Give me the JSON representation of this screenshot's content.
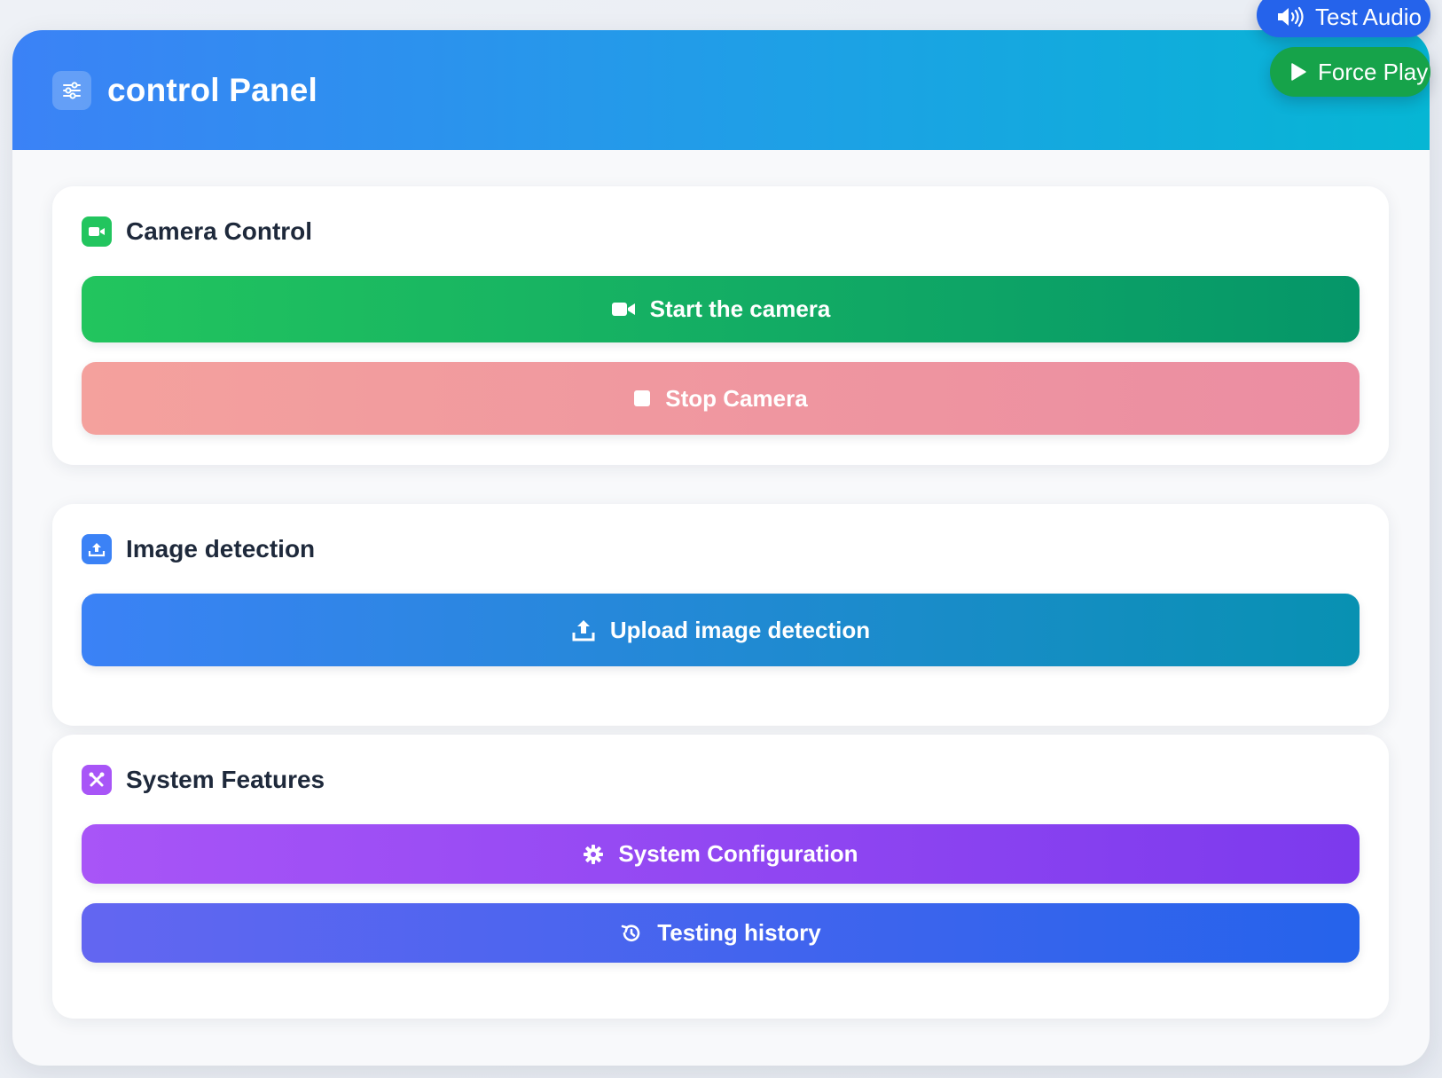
{
  "header": {
    "title": "control Panel",
    "icon": "sliders-icon"
  },
  "floating": {
    "test_audio_label": "Test Audio",
    "force_play_label": "Force Play"
  },
  "sections": {
    "camera": {
      "title": "Camera Control",
      "start_label": "Start the camera",
      "stop_label": "Stop Camera"
    },
    "image": {
      "title": "Image detection",
      "upload_label": "Upload image detection"
    },
    "system": {
      "title": "System Features",
      "config_label": "System Configuration",
      "history_label": "Testing history"
    }
  },
  "colors": {
    "header_start": "#3b82f6",
    "header_end": "#06b6d4",
    "green_start": "#22c55e",
    "green_end": "#059669",
    "stop_start": "#f4a19d",
    "stop_end": "#eb8da2",
    "upload_start": "#3b82f6",
    "upload_end": "#0891b2",
    "purple_start": "#a855f7",
    "purple_end": "#7c3aed",
    "indigo_start": "#6366f1",
    "indigo_end": "#2563eb",
    "test_audio_bg": "#2563eb",
    "force_play_bg": "#16a34a"
  }
}
